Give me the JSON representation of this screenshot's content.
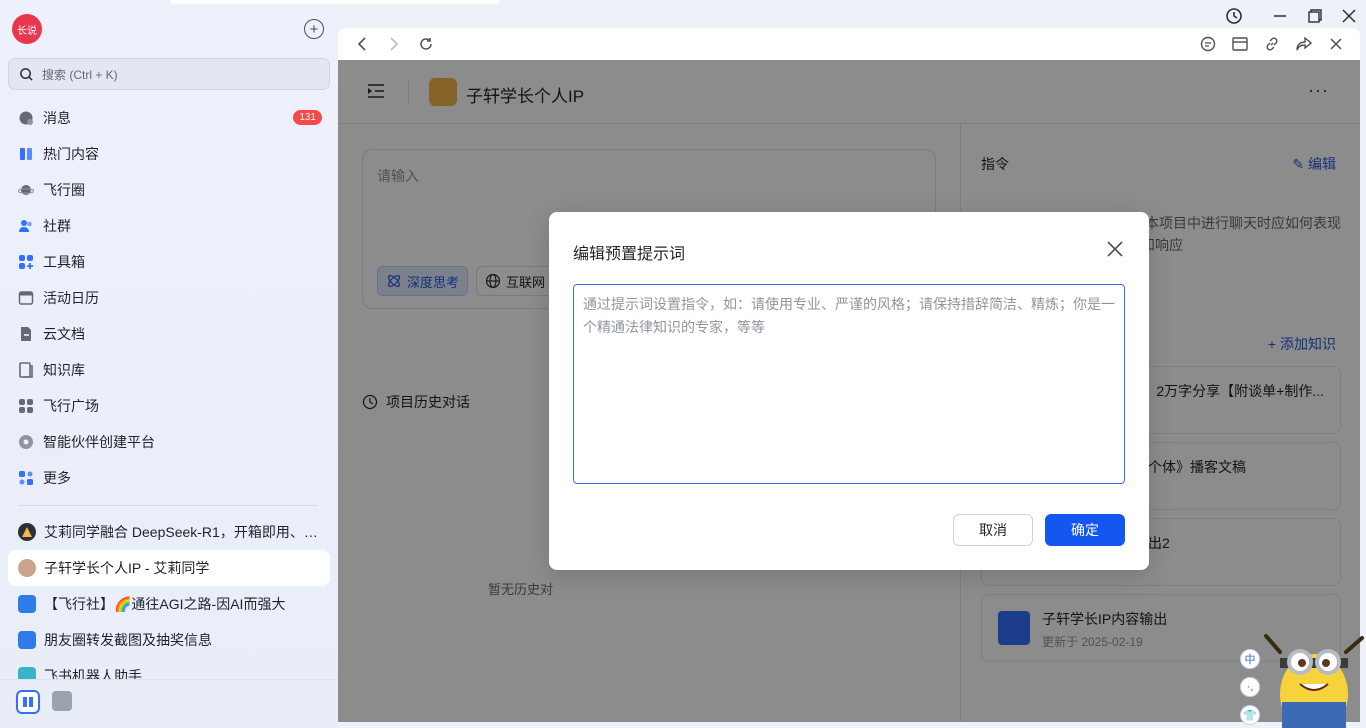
{
  "app": {
    "avatar_text": "长说",
    "search_placeholder": "搜索 (Ctrl + K)"
  },
  "sidebar": {
    "nav": [
      {
        "label": "消息",
        "icon": "message-icon",
        "badge": "131"
      },
      {
        "label": "热门内容",
        "icon": "book-icon"
      },
      {
        "label": "飞行圈",
        "icon": "planet-icon"
      },
      {
        "label": "社群",
        "icon": "people-icon"
      },
      {
        "label": "工具箱",
        "icon": "toolbox-icon"
      },
      {
        "label": "活动日历",
        "icon": "calendar-icon"
      },
      {
        "label": "云文档",
        "icon": "doc-icon"
      },
      {
        "label": "知识库",
        "icon": "library-icon"
      },
      {
        "label": "飞行广场",
        "icon": "grid-icon"
      },
      {
        "label": "智能伙伴创建平台",
        "icon": "gear-icon"
      },
      {
        "label": "更多",
        "icon": "more-icon"
      }
    ],
    "chats": [
      {
        "label": "艾莉同学融合 DeepSeek-R1，开箱即用、…",
        "active": false
      },
      {
        "label": "子轩学长个人IP - 艾莉同学",
        "active": true
      },
      {
        "label": "【飞行社】🌈通往AGI之路-因AI而强大",
        "active": false
      },
      {
        "label": "朋友圈转发截图及抽奖信息",
        "active": false
      },
      {
        "label": "飞书机器人助手",
        "active": false
      }
    ]
  },
  "page": {
    "title": "子轩学长个人IP",
    "more": "···",
    "input_placeholder": "请输入",
    "chip_deep": "深度思考",
    "chip_web": "互联网",
    "history_label": "项目历史对话",
    "empty_text": "暂无历史对",
    "right": {
      "label": "指令",
      "edit": "编辑",
      "desc_line1": "本项目中进行聊天时应如何表现",
      "desc_line2": "和响应",
      "add_knowledge": "添加知识",
      "cards": [
        {
          "title": "2万字分享【附谈单+制作..."
        },
        {
          "title": "个体》播客文稿"
        },
        {
          "title": "出2"
        },
        {
          "title": "子轩学长IP内容输出",
          "sub": "更新于 2025-02-19"
        }
      ]
    }
  },
  "dialog": {
    "title": "编辑预置提示词",
    "placeholder": "通过提示词设置指令，如：请使用专业、严谨的风格；请保持措辞简洁、精炼；你是一个精通法律知识的专家，等等",
    "cancel": "取消",
    "confirm": "确定"
  },
  "widget": {
    "zh": "中",
    "dots": "·,",
    "shirt": "👕"
  },
  "colors": {
    "accent": "#1456f0",
    "badge": "#f54a45"
  }
}
